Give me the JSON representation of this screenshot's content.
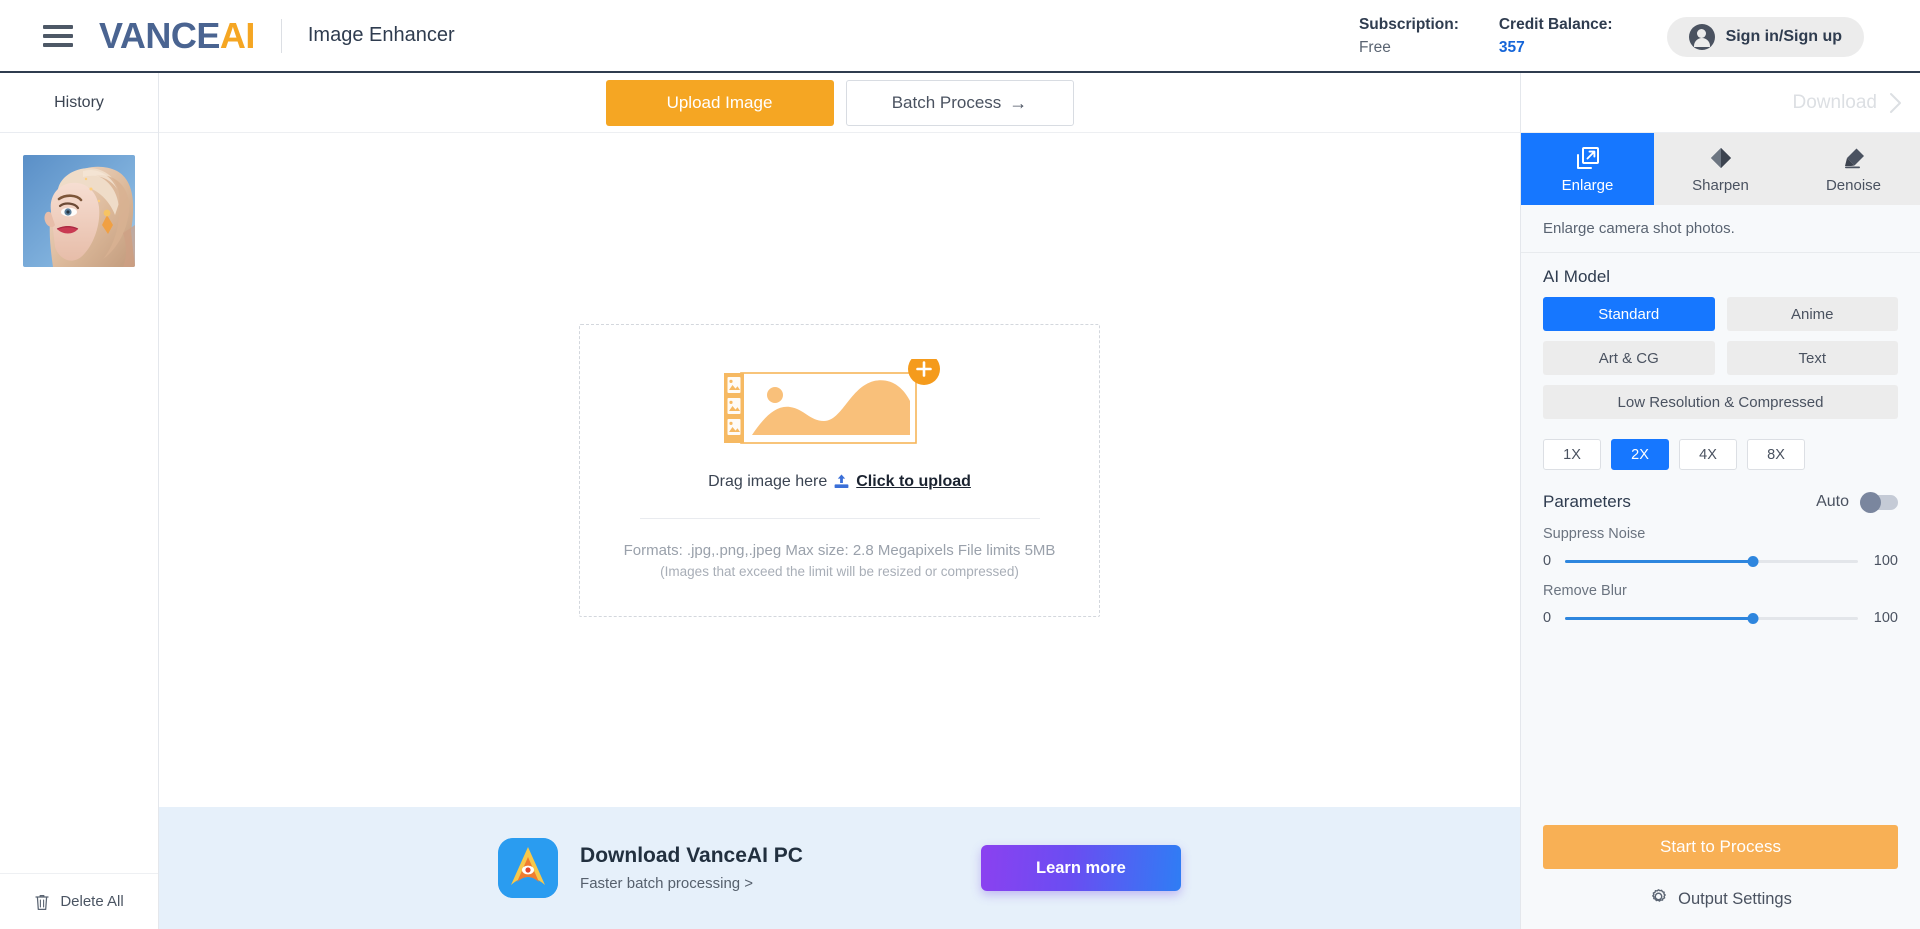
{
  "header": {
    "menu_icon": "hamburger-icon",
    "logo_part1": "VANCE",
    "logo_part2": "AI",
    "tool_title": "Image Enhancer",
    "subscription_label": "Subscription:",
    "subscription_value": "Free",
    "credit_label": "Credit Balance:",
    "credit_value": "357",
    "signin_label": "Sign in/Sign up",
    "signin_icon": "user-avatar-icon"
  },
  "history": {
    "title": "History",
    "thumbnail_alt": "portrait-thumbnail",
    "delete_all_label": "Delete All",
    "delete_icon": "trash-icon"
  },
  "toolbar": {
    "upload_label": "Upload Image",
    "batch_label": "Batch Process",
    "batch_arrow": "→"
  },
  "dropzone": {
    "prompt_prefix": "Drag image here",
    "prompt_link": "Click to upload",
    "upload_icon": "upload-icon",
    "formats": "Formats: .jpg,.png,.jpeg Max size: 2.8 Megapixels File limits 5MB",
    "note": "(Images that exceed the limit will be resized or compressed)"
  },
  "promo": {
    "icon": "vanceai-pc-app-icon",
    "title": "Download VanceAI PC",
    "subtitle": "Faster batch processing >",
    "cta_label": "Learn more"
  },
  "right_panel": {
    "download_label": "Download",
    "download_chevron_icon": "chevron-right-icon",
    "tabs": [
      {
        "label": "Enlarge",
        "icon": "enlarge-icon",
        "active": true
      },
      {
        "label": "Sharpen",
        "icon": "sharpen-icon",
        "active": false
      },
      {
        "label": "Denoise",
        "icon": "denoise-icon",
        "active": false
      }
    ],
    "description": "Enlarge camera shot photos.",
    "model_section_title": "AI Model",
    "models": [
      {
        "label": "Standard",
        "active": true,
        "width": "half"
      },
      {
        "label": "Anime",
        "active": false,
        "width": "half"
      },
      {
        "label": "Art & CG",
        "active": false,
        "width": "half"
      },
      {
        "label": "Text",
        "active": false,
        "width": "half"
      },
      {
        "label": "Low Resolution & Compressed",
        "active": false,
        "width": "full"
      }
    ],
    "scales": [
      {
        "label": "1X",
        "active": false
      },
      {
        "label": "2X",
        "active": true
      },
      {
        "label": "4X",
        "active": false
      },
      {
        "label": "8X",
        "active": false
      }
    ],
    "parameters_title": "Parameters",
    "auto_label": "Auto",
    "auto_enabled": false,
    "sliders": [
      {
        "label": "Suppress Noise",
        "min": "0",
        "max": "100",
        "value": 64
      },
      {
        "label": "Remove Blur",
        "min": "0",
        "max": "100",
        "value": 64
      }
    ],
    "process_label": "Start to Process",
    "output_settings_label": "Output Settings",
    "output_settings_icon": "gear-icon"
  },
  "colors": {
    "accent_blue": "#1677ff",
    "accent_orange": "#f5a623",
    "process_orange": "#f8b055",
    "credit_blue": "#1565d8",
    "promo_bg": "#e6f0fa"
  }
}
